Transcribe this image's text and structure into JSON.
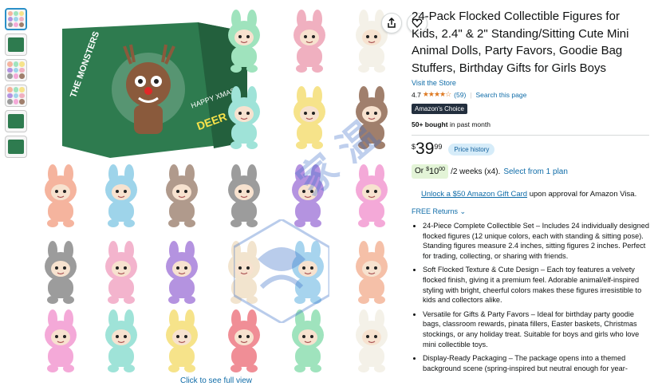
{
  "thumbnails": [
    {
      "kind": "grid",
      "active": true
    },
    {
      "kind": "box",
      "active": false
    },
    {
      "kind": "grid",
      "active": false
    },
    {
      "kind": "grid",
      "active": false
    },
    {
      "kind": "box",
      "active": false
    },
    {
      "kind": "box",
      "active": false
    }
  ],
  "image": {
    "box_text": [
      "THE MONSTERS",
      "HAPPY XMAS",
      "DEER"
    ],
    "view_full_label": "Click to see full view",
    "figure_colors": [
      "#9fe3bd",
      "#f0b0c0",
      "#f4f1e8",
      "#9fe3d8",
      "#f6e38a",
      "#a07f6c",
      "#f5b49e",
      "#9ed4ea",
      "#b09a8c",
      "#9c9c9c",
      "#b493e0",
      "#f4a9d8",
      "#9c9c9c",
      "#f3b4cd",
      "#b493e0",
      "#f2e4ce",
      "#a7d4ee",
      "#f5c0a8",
      "#f4a9d8",
      "#9fe3d8",
      "#f6e38a",
      "#f08e96",
      "#9fe3bd",
      "#f4f1e8"
    ],
    "watermark_text": "家 温",
    "icons": [
      "share-icon",
      "heart-icon"
    ]
  },
  "product": {
    "title": "24-Pack Flocked Collectible Figures for Kids, 2.4\" & 2\" Standing/Sitting Cute Mini Animal Dolls, Party Favors, Goodie Bag Stuffers, Birthday Gifts for Girls Boys",
    "store_link": "Visit the Store",
    "rating_value": "4.7",
    "rating_stars": "★★★★☆",
    "rating_count": "(59)",
    "search_link": "Search this page",
    "choice_badge": "Amazon's Choice",
    "bought_bold": "50+ bought",
    "bought_rest": " in past month",
    "price_currency": "$",
    "price_dollars": "39",
    "price_cents": "99",
    "price_history": "Price history",
    "plan_or": "Or",
    "plan_currency": "$",
    "plan_amount": "10",
    "plan_cents": "00",
    "plan_period": "/2 weeks (x4).",
    "plan_link": "Select from 1 plan",
    "giftcard_link": "Unlock a $50 Amazon Gift Card",
    "giftcard_rest": " upon approval for Amazon Visa.",
    "returns": "FREE Returns ⌄",
    "bullets": [
      "24-Piece Complete Collectible Set – Includes 24 individually designed flocked figures (12 unique colors, each with standing & sitting pose). Standing figures measure 2.4 inches, sitting figures 2 inches. Perfect for trading, collecting, or sharing with friends.",
      "Soft Flocked Texture & Cute Design – Each toy features a velvety flocked finish, giving it a premium feel. Adorable animal/elf-inspired styling with bright, cheerful colors makes these figures irresistible to kids and collectors alike.",
      "Versatile for Gifts & Party Favors – Ideal for birthday party goodie bags, classroom rewards, pinata fillers, Easter baskets, Christmas stockings, or any holiday treat. Suitable for boys and girls who love mini collectible toys.",
      "Display-Ready Packaging – The package opens into a themed background scene (spring-inspired but neutral enough for year-"
    ]
  }
}
